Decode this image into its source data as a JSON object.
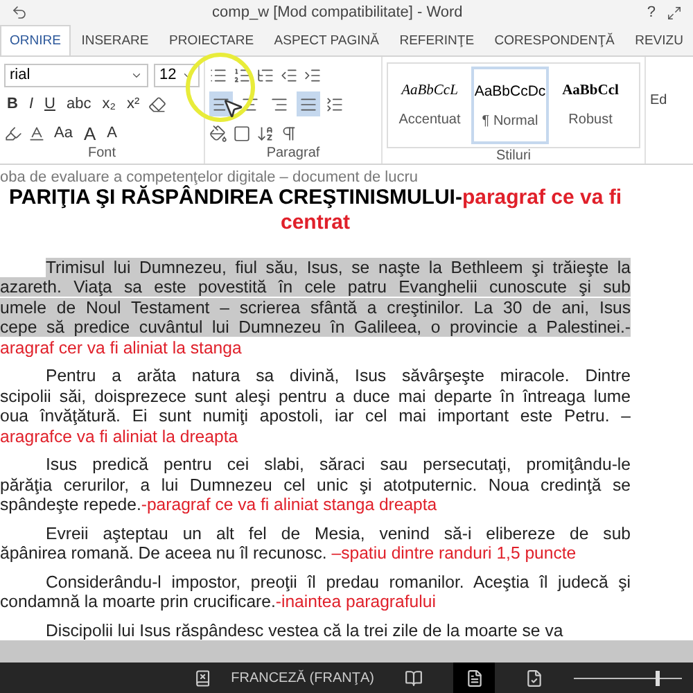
{
  "window": {
    "title": "comp_w [Mod compatibilitate] - Word",
    "help": "?"
  },
  "tabs": [
    {
      "label": "ORNIRE",
      "selected": true
    },
    {
      "label": "INSERARE",
      "selected": false
    },
    {
      "label": "PROIECTARE",
      "selected": false
    },
    {
      "label": "ASPECT PAGINĂ",
      "selected": false
    },
    {
      "label": "REFERINŢE",
      "selected": false
    },
    {
      "label": "CORESPONDENŢĂ",
      "selected": false
    },
    {
      "label": "REVIZU",
      "selected": false
    }
  ],
  "font_group": {
    "font": "rial",
    "size": "12",
    "format_buttons": [
      "B",
      "I",
      "U",
      "abc",
      "x₂",
      "x²"
    ],
    "case_button": "Aa",
    "grow": "A",
    "shrink": "A",
    "label": "Font"
  },
  "paragraph_group": {
    "align": [
      {
        "kind": "left",
        "highlighted": true
      },
      {
        "kind": "center",
        "highlighted": false
      },
      {
        "kind": "right",
        "highlighted": false
      },
      {
        "kind": "justify",
        "highlighted": true
      }
    ],
    "label": "Paragraf"
  },
  "styles_group": {
    "styles": [
      {
        "sample": "AaBbCcL",
        "name": "Accentuat",
        "kind": "italic",
        "selected": false
      },
      {
        "sample": "AaBbCcDc",
        "name": "¶ Normal",
        "kind": "normal",
        "selected": true
      },
      {
        "sample": "AaBbCcl",
        "name": "Robust",
        "kind": "bold",
        "selected": false
      }
    ],
    "label": "Stiluri"
  },
  "editing_group": {
    "label": "Ed"
  },
  "document": {
    "header": "oba de evaluare  a competenţelor digitale – document de lucru",
    "title": {
      "text": "PARIŢIA ŞI RĂSPÂNDIREA CREŞTINISMULUI-",
      "note": "paragraf ce va fi",
      "note_2": "centrat"
    },
    "paragraphs": [
      {
        "selected": true,
        "lines": [
          {
            "text": "Trimisul lui Dumnezeu, fiul său, Isus, se naşte la Bethleem şi trăieşte la"
          },
          {
            "text": "azareth. Viaţa sa este povestită în cele patru Evanghelii cunoscute şi sub"
          },
          {
            "text": "umele de Noul Testament – scrierea sfântă a creştinilor. La 30 de ani, Isus"
          },
          {
            "text": "cepe să predice cuvântul lui Dumnezeu în Galileea, o provincie a Palestinei.-"
          },
          {
            "note": "aragraf cer va fi aliniat la stanga"
          }
        ]
      },
      {
        "selected": false,
        "lines": [
          {
            "text": "Pentru a arăta natura sa divină, Isus săvârşeşte miracole. Dintre"
          },
          {
            "text": "scipolii săi, doisprezece sunt aleşi pentru a duce mai departe în întreaga lume"
          },
          {
            "text": "oua învăţătură. Ei sunt numiţi apostoli, iar cel mai important este Petru. –"
          },
          {
            "note": "aragrafce va fi aliniat la dreapta"
          }
        ]
      },
      {
        "selected": false,
        "lines": [
          {
            "text": "Isus predică pentru cei slabi, săraci sau persecutaţi, promiţându-le"
          },
          {
            "text": "părăţia cerurilor, a lui Dumnezeu cel unic şi atotputernic. Noua credinţă se"
          },
          {
            "text": "spândeşte repede.",
            "note": "-paragraf ce va fi aliniat stanga dreapta"
          }
        ]
      },
      {
        "selected": false,
        "lines": [
          {
            "text": "Evreii aşteptau un alt fel de Mesia, venind să-i elibereze de sub"
          },
          {
            "text": "ăpânirea romană. De aceea nu îl recunosc. ",
            "note": "–spatiu dintre randuri 1,5 puncte"
          }
        ]
      },
      {
        "selected": false,
        "lines": [
          {
            "text": "Considerându-l impostor, preoţii îl predau romanilor. Aceştia îl judecă şi"
          },
          {
            "text": "condamnă la moarte prin crucificare.",
            "note": "-inaintea paragrafului"
          }
        ]
      },
      {
        "selected": false,
        "lines": [
          {
            "text": "Discipolii lui Isus răspândesc vestea că la trei zile de la moarte se va"
          }
        ]
      }
    ]
  },
  "status_bar": {
    "language": "FRANCEZĂ (FRANŢA)",
    "zoom": {
      "level": 0.75
    }
  }
}
